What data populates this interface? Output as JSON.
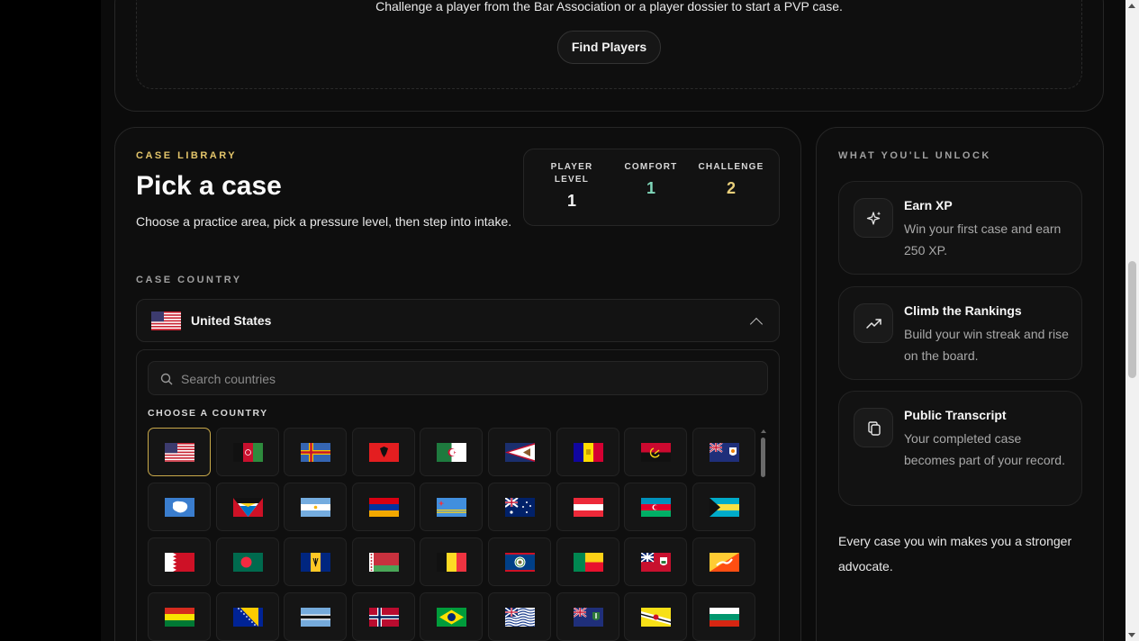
{
  "pvp": {
    "text": "Challenge a player from the Bar Association or a player dossier to start a PVP case.",
    "button_label": "Find Players"
  },
  "case_library": {
    "eyebrow": "CASE LIBRARY",
    "title": "Pick a case",
    "description": "Choose a practice area, pick a pressure level, then step into intake."
  },
  "stats": [
    {
      "label": "PLAYER LEVEL",
      "value": "1",
      "color": "#f5f5f5"
    },
    {
      "label": "COMFORT",
      "value": "1",
      "color": "#7fd6b9"
    },
    {
      "label": "CHALLENGE",
      "value": "2",
      "color": "#e9cf7a"
    }
  ],
  "country": {
    "section_label": "CASE COUNTRY",
    "selected": "United States",
    "search_placeholder": "Search countries",
    "choose_label": "CHOOSE A COUNTRY",
    "flags": [
      "us-flag-icon",
      "af-flag-icon",
      "ax-flag-icon",
      "al-flag-icon",
      "dz-flag-icon",
      "as-flag-icon",
      "ad-flag-icon",
      "ao-flag-icon",
      "ai-flag-icon",
      "aq-flag-icon",
      "ag-flag-icon",
      "ar-flag-icon",
      "am-flag-icon",
      "aw-flag-icon",
      "au-flag-icon",
      "at-flag-icon",
      "az-flag-icon",
      "bs-flag-icon",
      "bh-flag-icon",
      "bd-flag-icon",
      "bb-flag-icon",
      "by-flag-icon",
      "be-flag-icon",
      "bz-flag-icon",
      "bj-flag-icon",
      "bm-flag-icon",
      "bt-flag-icon",
      "bo-flag-icon",
      "ba-flag-icon",
      "bw-flag-icon",
      "bv-flag-icon",
      "br-flag-icon",
      "io-flag-icon",
      "vg-flag-icon",
      "bn-flag-icon",
      "bg-flag-icon"
    ]
  },
  "unlock": {
    "eyebrow": "WHAT YOU'LL UNLOCK",
    "items": [
      {
        "title": "Earn XP",
        "desc": "Win your first case and earn 250 XP.",
        "icon": "sparkle-icon"
      },
      {
        "title": "Climb the Rankings",
        "desc": "Build your win streak and rise on the board.",
        "icon": "trending-up-icon"
      },
      {
        "title": "Public Transcript",
        "desc": "Your completed case becomes part of your record.",
        "icon": "copy-icon"
      }
    ],
    "footer": "Every case you win makes you a stronger advocate."
  },
  "colors": {
    "accent_gold": "#e3c56a",
    "comfort_teal": "#7fd6b9",
    "challenge_gold": "#e9cf7a"
  }
}
